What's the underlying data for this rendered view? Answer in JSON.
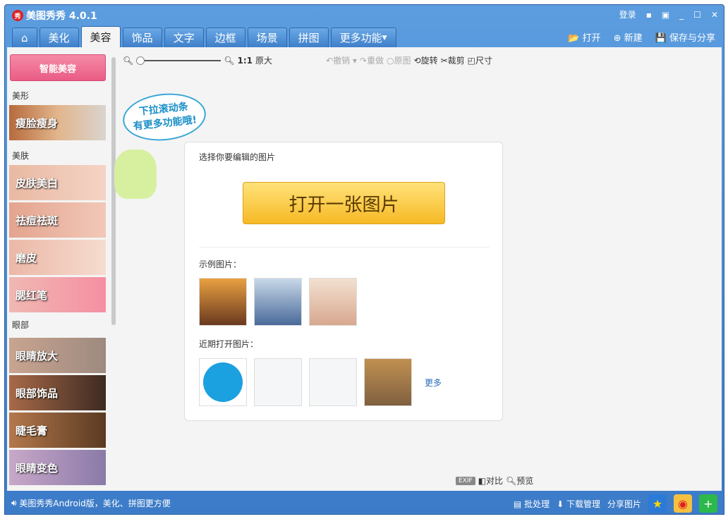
{
  "window": {
    "title": "美图秀秀 4.0.1",
    "login": "登录"
  },
  "tabs": [
    "美化",
    "美容",
    "饰品",
    "文字",
    "边框",
    "场景",
    "拼图",
    "更多功能"
  ],
  "actions": {
    "open": "打开",
    "new": "新建",
    "save_share": "保存与分享"
  },
  "sidebar": {
    "smart": "智能美容",
    "sections": [
      {
        "label": "美形",
        "items": [
          "瘦脸瘦身"
        ]
      },
      {
        "label": "美肤",
        "items": [
          "皮肤美白",
          "祛痘祛斑",
          "磨皮",
          "腮红笔"
        ]
      },
      {
        "label": "眼部",
        "items": [
          "眼睛放大",
          "眼部饰品",
          "睫毛膏",
          "眼睛变色"
        ]
      }
    ]
  },
  "toolbar": {
    "zoom_label": "1:1",
    "original_size": "原大",
    "undo": "撤销",
    "redo": "重做",
    "original": "原图",
    "rotate": "旋转",
    "crop": "裁剪",
    "size": "尺寸"
  },
  "bubble": {
    "line1": "下拉滚动条",
    "line2": "有更多功能哦!"
  },
  "card": {
    "prompt": "选择你要编辑的图片",
    "open_button": "打开一张图片",
    "examples": "示例图片：",
    "recent": "近期打开图片：",
    "more": "更多"
  },
  "bottom_tools": {
    "exif": "EXIF",
    "compare": "对比",
    "preview": "预览"
  },
  "status": {
    "message": "美图秀秀Android版，美化、拼图更方便",
    "batch": "批处理",
    "download": "下载管理",
    "share": "分享图片"
  }
}
